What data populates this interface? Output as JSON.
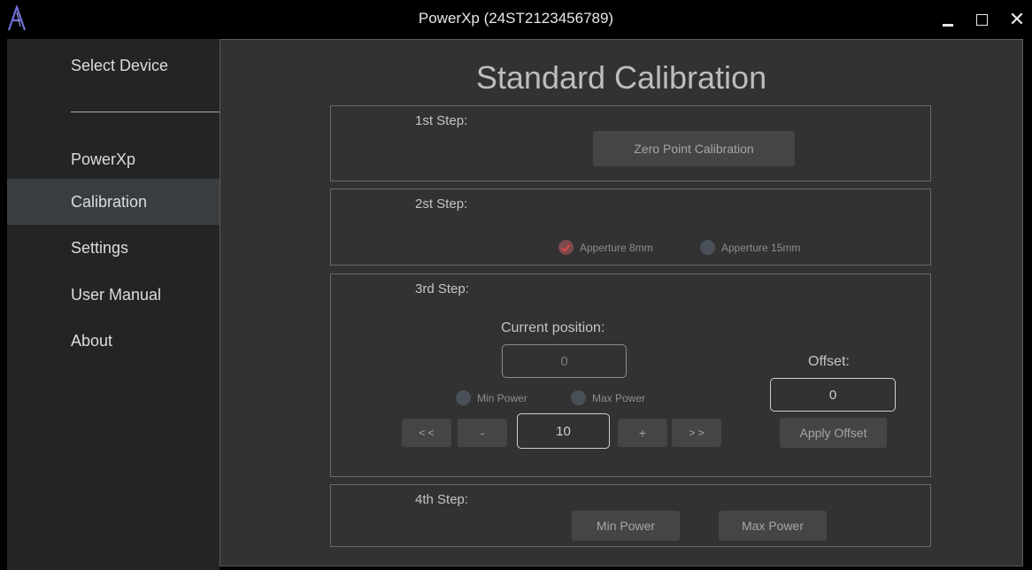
{
  "window": {
    "title": "PowerXp (24ST2123456789)",
    "logo_icon": "logo-a-icon",
    "controls": {
      "minimize_icon": "minimize-icon",
      "maximize_icon": "maximize-icon",
      "close_glyph": "✕"
    }
  },
  "sidebar": {
    "select_device": "Select Device",
    "items": [
      {
        "label": "PowerXp",
        "active": false
      },
      {
        "label": "Calibration",
        "active": true
      },
      {
        "label": "Settings",
        "active": false
      },
      {
        "label": "User Manual",
        "active": false
      },
      {
        "label": "About",
        "active": false
      }
    ]
  },
  "main": {
    "title": "Standard Calibration",
    "step1": {
      "label": "1st Step:",
      "button": "Zero Point Calibration"
    },
    "step2": {
      "label": "2st Step:",
      "options": [
        {
          "label": "Apperture 8mm",
          "checked": true
        },
        {
          "label": "Apperture 15mm",
          "checked": false
        }
      ]
    },
    "step3": {
      "label": "3rd Step:",
      "current_position_label": "Current position:",
      "current_position_value": "0",
      "radios": [
        {
          "label": "Min Power",
          "checked": false
        },
        {
          "label": "Max Power",
          "checked": false
        }
      ],
      "buttons": {
        "fast_back": "< <",
        "minus": "-",
        "plus": "+",
        "fast_forward": "> >"
      },
      "step_value": "10",
      "offset_label": "Offset:",
      "offset_value": "0",
      "apply_offset": "Apply Offset"
    },
    "step4": {
      "label": "4th Step:",
      "min_power": "Min Power",
      "max_power": "Max Power"
    }
  },
  "colors": {
    "accent_check": "#e04848",
    "background": "#323232",
    "sidebar": "#242424",
    "sidebar_active": "#3a3d40"
  }
}
